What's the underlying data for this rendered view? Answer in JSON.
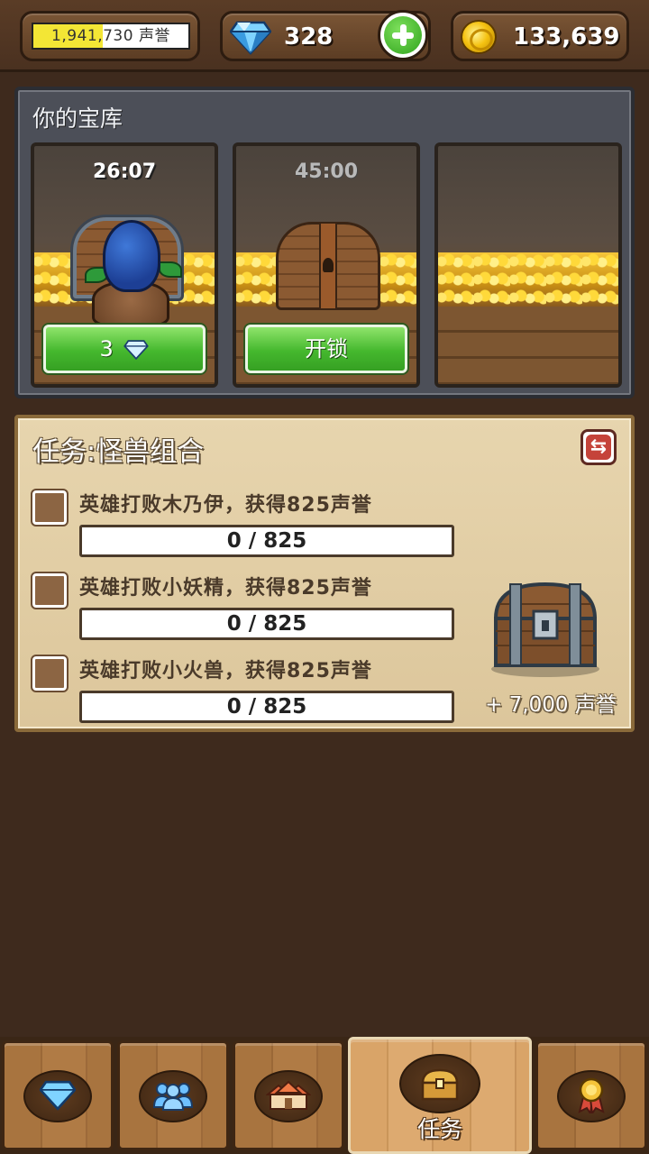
{
  "top_bar": {
    "fame_text": "1,941,730 声誉",
    "fame_progress_percent": 45,
    "gems": "328",
    "gold": "133,639"
  },
  "vault": {
    "title": "你的宝库",
    "slots": [
      {
        "timer": "26:07",
        "button_value": "3"
      },
      {
        "timer": "45:00",
        "button_label": "开锁"
      },
      {}
    ]
  },
  "mission": {
    "title": "任务:怪兽组合",
    "tasks": [
      {
        "text": "英雄打败木乃伊，获得825声誉",
        "progress": "0 / 825"
      },
      {
        "text": "英雄打败小妖精，获得825声誉",
        "progress": "0 / 825"
      },
      {
        "text": "英雄打败小火兽，获得825声誉",
        "progress": "0 / 825"
      }
    ],
    "reward": "+ 7,000 声誉"
  },
  "nav": {
    "items": [
      {
        "icon": "gem-icon"
      },
      {
        "icon": "heroes-icon"
      },
      {
        "icon": "village-icon"
      },
      {
        "icon": "treasure-chest-icon",
        "label": "任务",
        "active": true
      },
      {
        "icon": "medal-icon"
      }
    ]
  },
  "colors": {
    "background": "#3e2a1d",
    "button_green": "#45b82e",
    "parchment": "#e7d5ae",
    "fame_fill": "#f3e635"
  }
}
